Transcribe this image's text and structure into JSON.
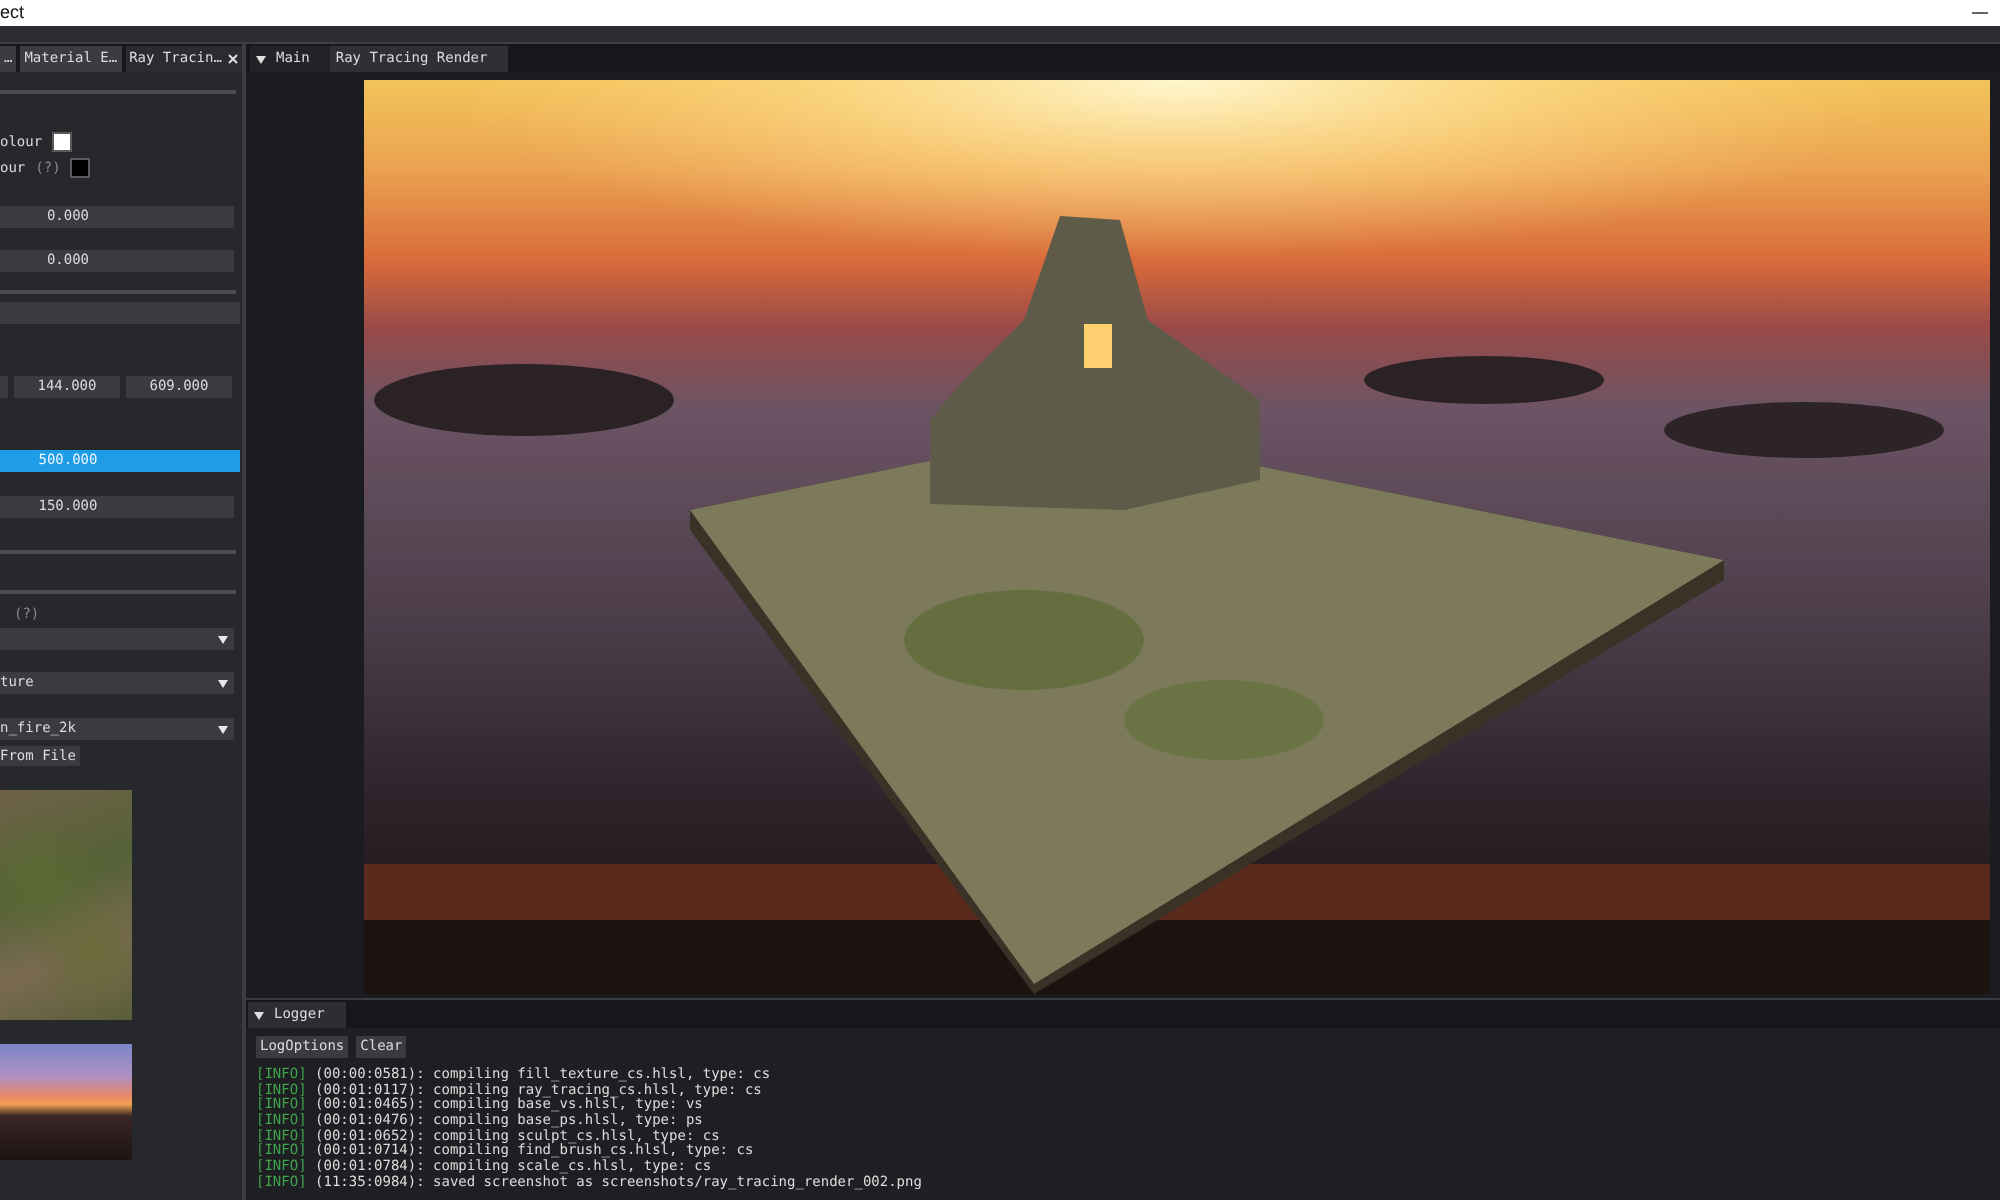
{
  "window": {
    "title": "ect"
  },
  "left_panel": {
    "tabs": [
      {
        "label": "…",
        "selected": false
      },
      {
        "label": "Material E…",
        "selected": false
      },
      {
        "label": "Ray Tracin…",
        "selected": true
      }
    ],
    "items": [
      {
        "kind": "separator"
      },
      {
        "kind": "color",
        "label": "olour",
        "color": "#ffffff"
      },
      {
        "kind": "color",
        "label": "our",
        "hint": "(?)",
        "color": "#000000"
      },
      {
        "kind": "field",
        "value": "0.000"
      },
      {
        "kind": "field",
        "value": "0.000"
      },
      {
        "kind": "separator"
      },
      {
        "kind": "field"
      },
      {
        "kind": "vector",
        "values": [
          "144.000",
          "609.000"
        ]
      },
      {
        "kind": "drag",
        "value": "500.000",
        "active": true
      },
      {
        "kind": "field",
        "value": "150.000"
      },
      {
        "kind": "separator"
      },
      {
        "kind": "separator"
      },
      {
        "kind": "hint",
        "hint": "(?)"
      },
      {
        "kind": "dropdown"
      },
      {
        "kind": "dropdown",
        "value": "ture"
      },
      {
        "kind": "dropdown",
        "value": "n_fire_2k"
      },
      {
        "kind": "button",
        "label": "From File"
      },
      {
        "kind": "texture_preview"
      },
      {
        "kind": "panorama_preview"
      }
    ]
  },
  "main": {
    "tabs": [
      {
        "label": "Main",
        "selected": false
      },
      {
        "label": "Ray Tracing Render",
        "selected": true
      }
    ]
  },
  "logger": {
    "tabs": [
      {
        "label": "Logger",
        "selected": true
      }
    ],
    "buttons": [
      "LogOptions",
      "Clear"
    ],
    "lines": [
      {
        "kind": "info",
        "tag": "[INFO]",
        "text": "(00:00:0581): compiling fill_texture_cs.hlsl, type: cs"
      },
      {
        "kind": "info",
        "tag": "[INFO]",
        "text": "(00:01:0117): compiling ray_tracing_cs.hlsl, type: cs"
      },
      {
        "kind": "info",
        "tag": "[INFO]",
        "text": "(00:01:0465): compiling base_vs.hlsl, type: vs"
      },
      {
        "kind": "info",
        "tag": "[INFO]",
        "text": "(00:01:0476): compiling base_ps.hlsl, type: ps"
      },
      {
        "kind": "info",
        "tag": "[INFO]",
        "text": "(00:01:0652): compiling sculpt_cs.hlsl, type: cs"
      },
      {
        "kind": "info",
        "tag": "[INFO]",
        "text": "(00:01:0714): compiling find_brush_cs.hlsl, type: cs"
      },
      {
        "kind": "info",
        "tag": "[INFO]",
        "text": "(00:01:0784): compiling scale_cs.hlsl, type: cs"
      },
      {
        "kind": "info",
        "tag": "[INFO]",
        "text": "(11:35:0984): saved screenshot as screenshots/ray_tracing_render_002.png"
      }
    ]
  }
}
